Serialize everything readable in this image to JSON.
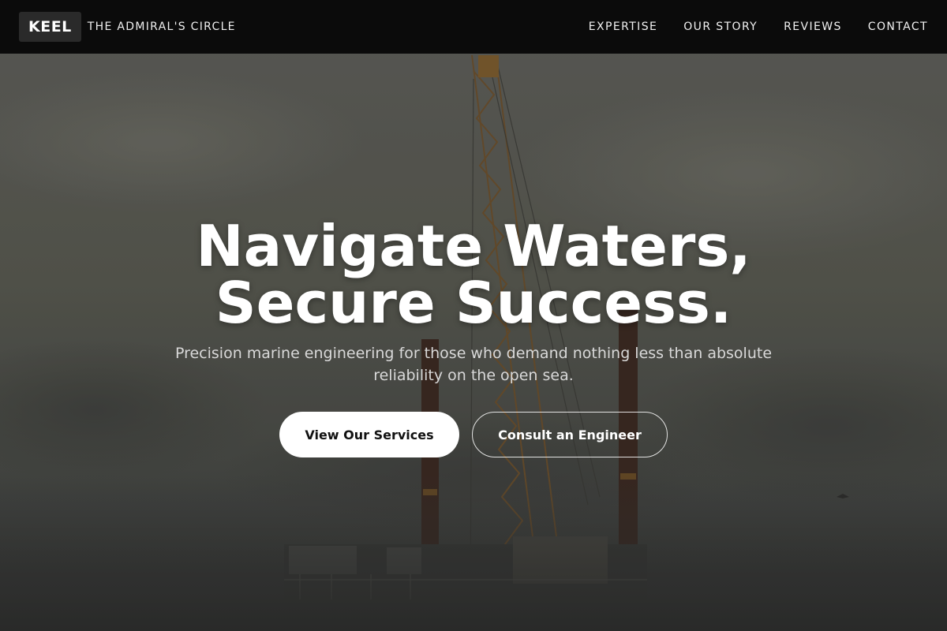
{
  "nav": {
    "logo": "KEEL",
    "brand_name": "THE ADMIRAL'S CIRCLE",
    "links": [
      "EXPERTISE",
      "OUR STORY",
      "REVIEWS",
      "CONTACT"
    ]
  },
  "hero": {
    "title_line1": "Navigate Waters,",
    "title_line2": "Secure Success.",
    "subtitle": "Precision marine engineering for those who demand nothing less than absolute reliability on the open sea.",
    "primary_cta": "View Our Services",
    "secondary_cta": "Consult an Engineer",
    "background": "photo of an offshore jack-up rig with a tall lattice crane under an overcast sky"
  },
  "colors": {
    "nav_bg": "#0b0b0b",
    "logo_bg": "#2a2a2a",
    "text_white": "#ffffff",
    "subtitle_text": "#d9d9d9"
  }
}
